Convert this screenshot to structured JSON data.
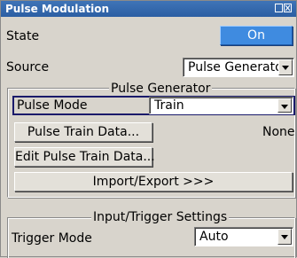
{
  "window": {
    "title": "Pulse Modulation"
  },
  "state": {
    "label": "State",
    "button": "On"
  },
  "source": {
    "label": "Source",
    "value": "Pulse Generator"
  },
  "pulse_generator": {
    "group_title": "Pulse Generator",
    "mode_label": "Pulse Mode",
    "mode_value": "Train",
    "train_data_button": "Pulse Train Data...",
    "train_data_status": "None",
    "edit_train_button": "Edit Pulse Train Data...",
    "import_export_button": "Import/Export >>>"
  },
  "trigger": {
    "group_title": "Input/Trigger Settings",
    "mode_label": "Trigger Mode",
    "mode_value": "Auto"
  },
  "colors": {
    "titlebar": "#2b5ea3",
    "on_button": "#3f8be0",
    "selection_border": "#1a1a6a"
  }
}
